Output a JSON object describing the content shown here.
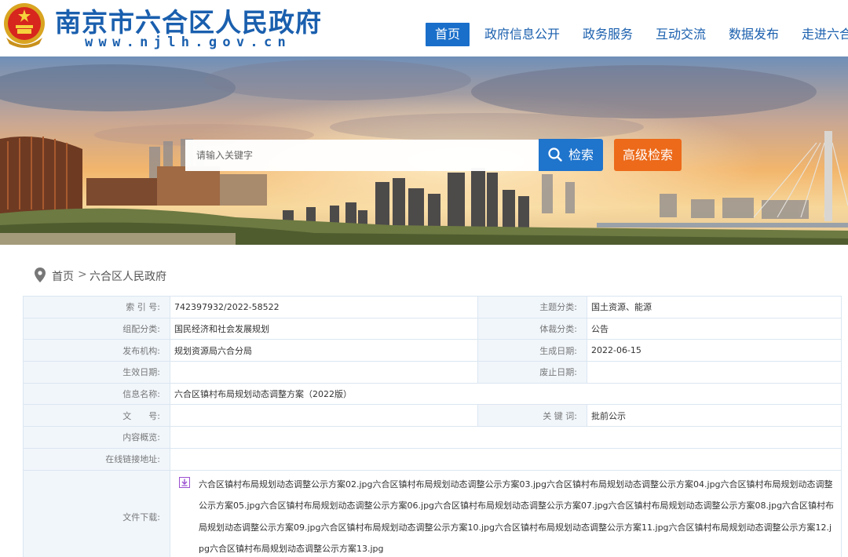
{
  "header": {
    "site_title": "南京市六合区人民政府",
    "site_domain": "www.njlh.gov.cn",
    "brand_color": "#1a5fae",
    "nav": [
      "首页",
      "政府信息公开",
      "政务服务",
      "互动交流",
      "数据发布",
      "走进六合"
    ],
    "active_nav": "首页"
  },
  "search": {
    "placeholder": "请输入关键字",
    "search_label": "检索",
    "advanced_label": "高级检索",
    "search_color": "#1f74cc",
    "advanced_color": "#ec6a1a"
  },
  "breadcrumb": {
    "home": "首页",
    "separator": ">",
    "current": "六合区人民政府"
  },
  "info": {
    "index_no_label": "索 引 号:",
    "index_no": "742397932/2022-58522",
    "subject_label": "主题分类:",
    "subject": "国土资源、能源",
    "category_label": "组配分类:",
    "category": "国民经济和社会发展规划",
    "genre_label": "体裁分类:",
    "genre": "公告",
    "publisher_label": "发布机构:",
    "publisher": "规划资源局六合分局",
    "created_label": "生成日期:",
    "created": "2022-06-15",
    "effective_label": "生效日期:",
    "effective": "",
    "abolished_label": "废止日期:",
    "abolished": "",
    "name_label": "信息名称:",
    "name": "六合区镇村布局规划动态调整方案（2022版）",
    "doc_no_label": "文　　号:",
    "doc_no": "",
    "keywords_label": "关 键 词:",
    "keywords": "批前公示",
    "summary_label": "内容概览:",
    "summary": "",
    "link_label": "在线链接地址:",
    "link": "",
    "download_label": "文件下载:",
    "download_text": "六合区镇村布局规划动态调整公示方案02.jpg六合区镇村布局规划动态调整公示方案03.jpg六合区镇村布局规划动态调整公示方案04.jpg六合区镇村布局规划动态调整公示方案05.jpg六合区镇村布局规划动态调整公示方案06.jpg六合区镇村布局规划动态调整公示方案07.jpg六合区镇村布局规划动态调整公示方案08.jpg六合区镇村布局规划动态调整公示方案09.jpg六合区镇村布局规划动态调整公示方案10.jpg六合区镇村布局规划动态调整公示方案11.jpg六合区镇村布局规划动态调整公示方案12.jpg六合区镇村布局规划动态调整公示方案13.jpg"
  }
}
